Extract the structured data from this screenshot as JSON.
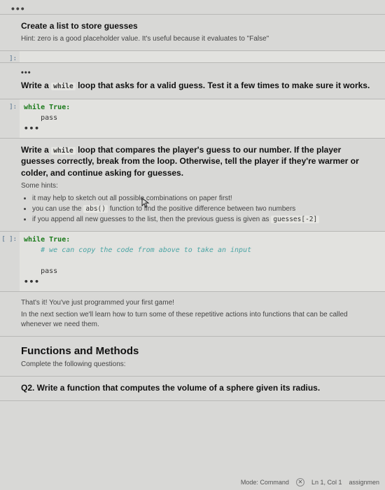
{
  "top_dots": "•••",
  "cells": {
    "c1": {
      "heading": "Create a list to store guesses",
      "hint": "Hint: zero is a good placeholder value. It's useful because it evaluates to \"False\""
    },
    "c2": {
      "prompt": "]:"
    },
    "c3": {
      "ellipsis": "•••",
      "heading_pre": "Write a ",
      "heading_code": "while",
      "heading_post": " loop that asks for a valid guess. Test it a few times to make sure it works."
    },
    "c4": {
      "prompt": "]:",
      "kw": "while",
      "bool": "True:",
      "body": "pass",
      "ellipsis": "•••"
    },
    "c5": {
      "heading_pre": "Write a ",
      "heading_code": "while",
      "heading_post": " loop that compares the player's guess to our number. If the player guesses correctly, break from the loop. Otherwise, tell the player if they're warmer or colder, and continue asking for guesses.",
      "hints_label": "Some hints:",
      "hints": [
        "it may help to sketch out all possible combinations on paper first!",
        "you can use the  abs()  function to find the positive difference between two numbers",
        "if you append all new guesses to the list, then the previous guess is given as  guesses[-2]"
      ],
      "hint_code1": "abs()",
      "hint_code2": "guesses[-2]"
    },
    "c6": {
      "prompt": "[ ]:",
      "kw": "while",
      "bool": "True:",
      "comment": "# we can copy the code from above to take an input",
      "body": "pass",
      "ellipsis": "•••"
    },
    "c7": {
      "line1": "That's it! You've just programmed your first game!",
      "line2": "In the next section we'll learn how to turn some of these repetitive actions into functions that can be called whenever we need them."
    },
    "c8": {
      "title": "Functions and Methods",
      "subtitle": "Complete the following questions:"
    },
    "c9": {
      "heading": "Q2. Write a function that computes the volume of a sphere given its radius."
    }
  },
  "statusbar": {
    "mode": "Mode: Command",
    "pos": "Ln 1, Col 1",
    "file": "assignmen"
  }
}
